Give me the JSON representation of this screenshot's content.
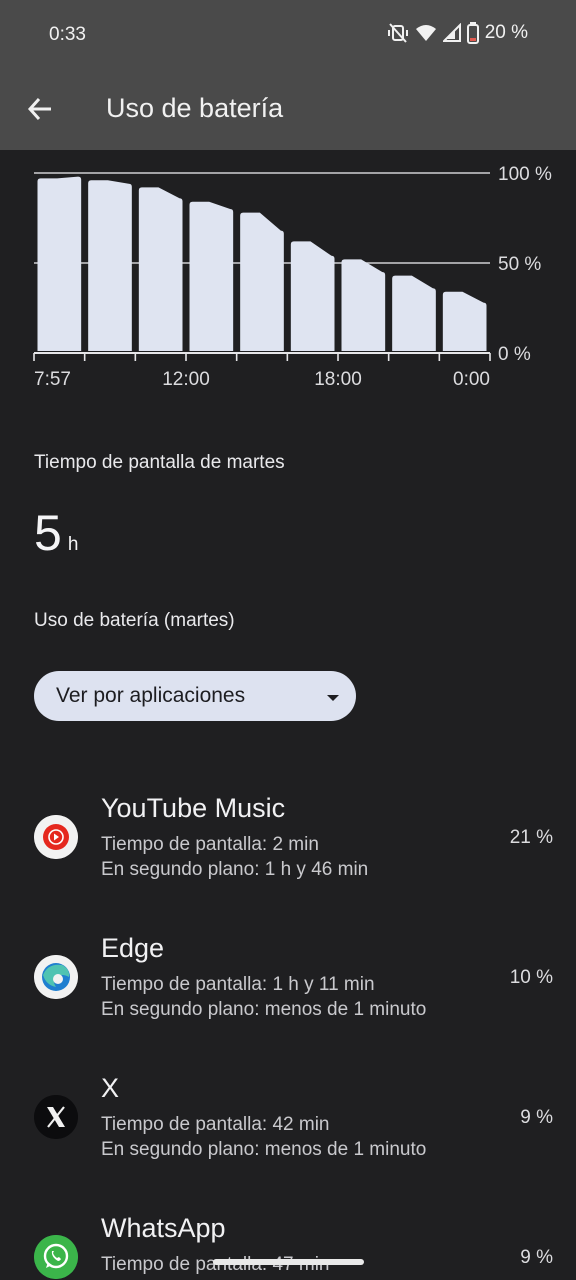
{
  "status_bar": {
    "time": "0:33",
    "battery": "20 %",
    "icons": [
      "vibrate-off-icon",
      "wifi-icon",
      "signal-icon",
      "battery-icon"
    ]
  },
  "app_bar": {
    "title": "Uso de batería",
    "back_icon": "arrow-back-icon"
  },
  "chart_data": {
    "type": "bar",
    "categories": [
      "1",
      "2",
      "3",
      "4",
      "5",
      "6",
      "7",
      "8",
      "9"
    ],
    "values": [
      97,
      96,
      92,
      84,
      78,
      62,
      52,
      43,
      34
    ],
    "y_tick_labels": [
      "100 %",
      "50 %",
      "0 %"
    ],
    "x_tick_labels": [
      "7:57",
      "12:00",
      "18:00",
      "0:00"
    ],
    "ylim": [
      0,
      100
    ],
    "grid": true,
    "bar_color": "#dfe4f1"
  },
  "screen_time": {
    "title": "Tiempo de pantalla de martes",
    "value": "5",
    "unit": "h"
  },
  "usage": {
    "title": "Uso de batería (martes)",
    "dropdown_label": "Ver por aplicaciones"
  },
  "apps": [
    {
      "name": "YouTube Music",
      "line1": "Tiempo de pantalla: 2 min",
      "line2": "En segundo plano: 1 h y 46 min",
      "percent": "21 %",
      "icon": "youtube-music-icon"
    },
    {
      "name": "Edge",
      "line1": "Tiempo de pantalla: 1 h y 11 min",
      "line2": "En segundo plano: menos de 1 minuto",
      "percent": "10 %",
      "icon": "edge-icon"
    },
    {
      "name": "X",
      "line1": "Tiempo de pantalla: 42 min",
      "line2": "En segundo plano: menos de 1 minuto",
      "percent": "9 %",
      "icon": "x-icon"
    },
    {
      "name": "WhatsApp",
      "line1": "Tiempo de pantalla: 47 min",
      "percent": "9 %",
      "icon": "whatsapp-icon"
    }
  ],
  "colors": {
    "background": "#1f1f21",
    "header": "#4a4a4a",
    "accent": "#dde2f0"
  }
}
